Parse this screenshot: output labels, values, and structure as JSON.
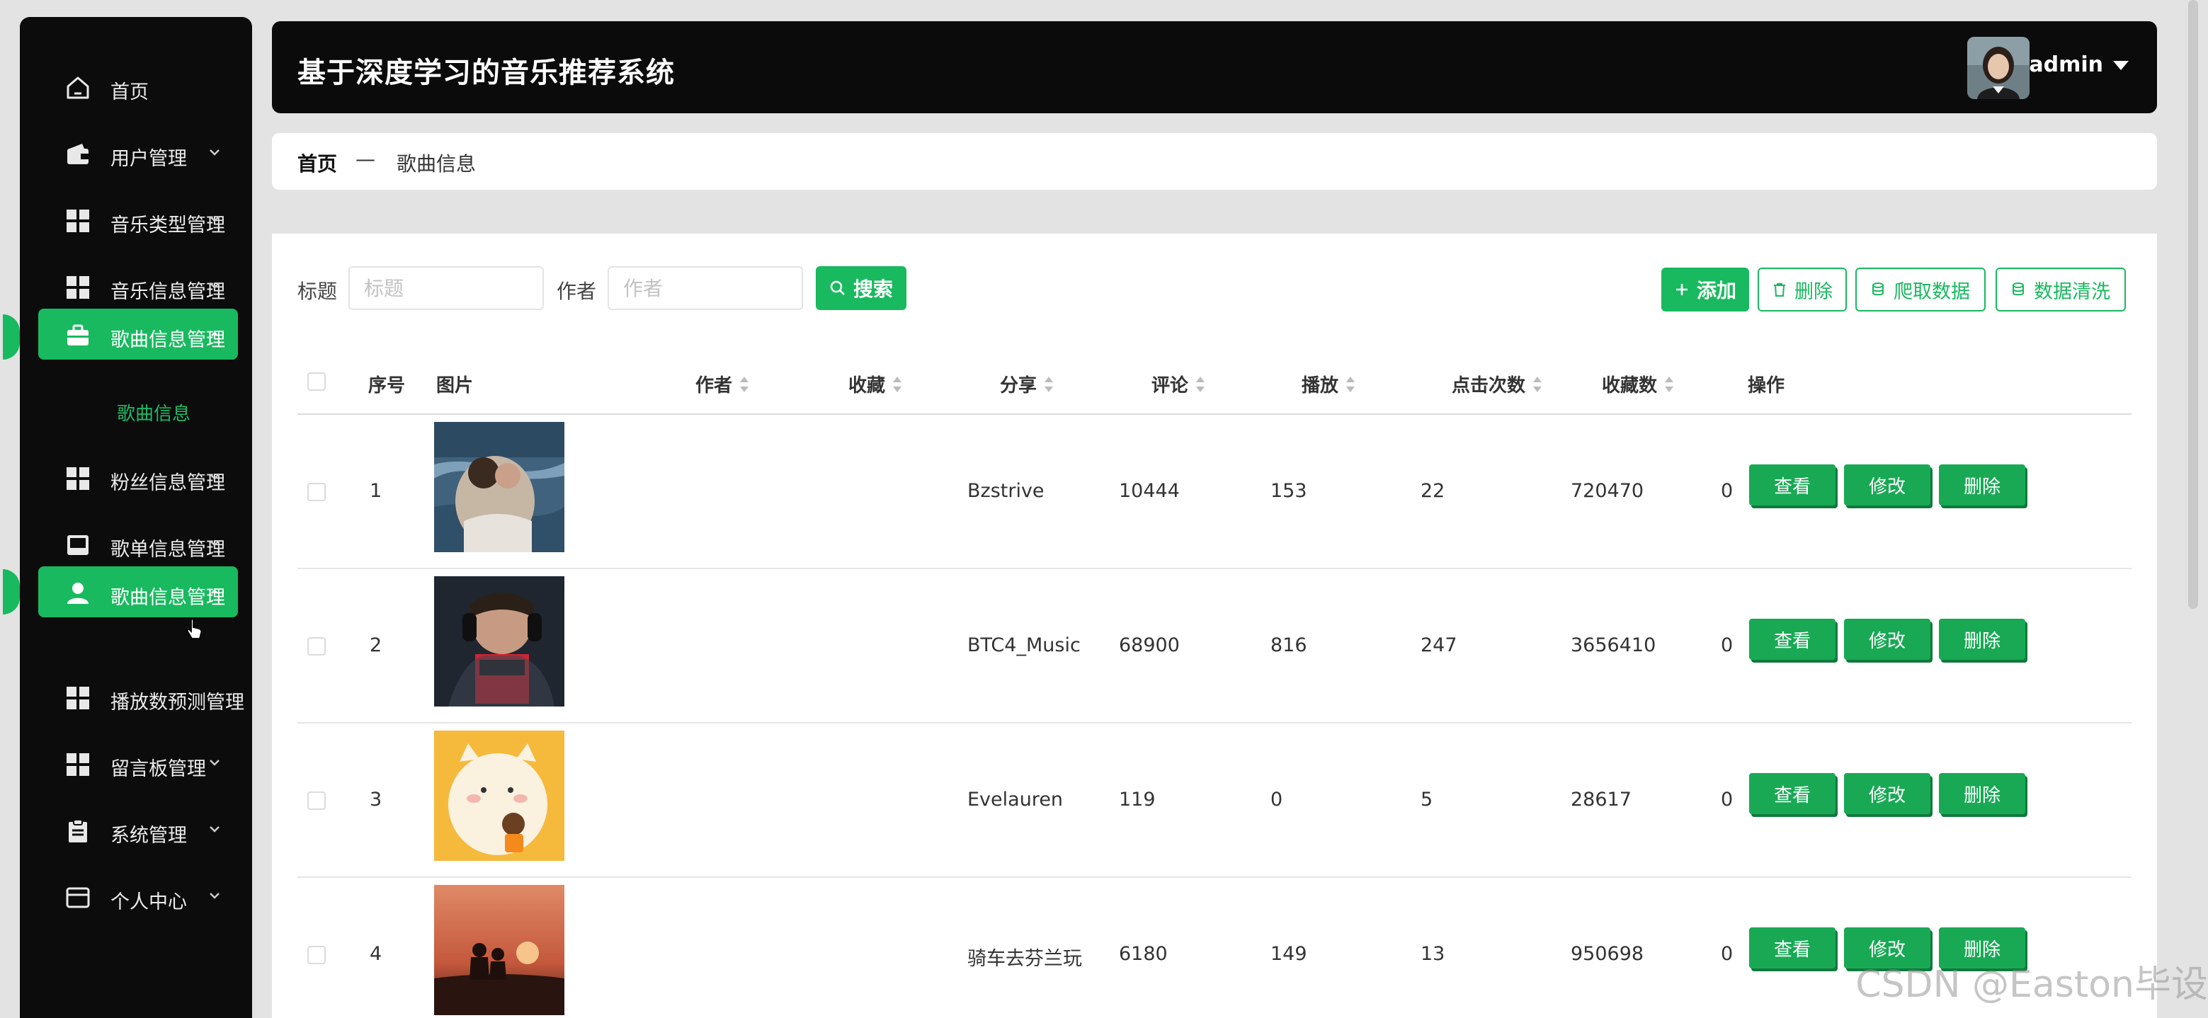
{
  "header": {
    "title": "基于深度学习的音乐推荐系统",
    "username": "admin"
  },
  "sidebar": {
    "items": [
      {
        "label": "首页",
        "icon": "home-icon"
      },
      {
        "label": "用户管理",
        "icon": "wallet-icon"
      },
      {
        "label": "音乐类型管理",
        "icon": "grid-icon"
      },
      {
        "label": "音乐信息管理",
        "icon": "grid-icon"
      },
      {
        "label": "歌曲信息管理",
        "icon": "briefcase-icon",
        "active": true
      },
      {
        "label": "歌曲信息",
        "sub": true
      },
      {
        "label": "粉丝信息管理",
        "icon": "grid-icon"
      },
      {
        "label": "歌单信息管理",
        "icon": "inbox-icon"
      },
      {
        "label": "歌曲信息管理",
        "icon": "user-icon",
        "active": true
      },
      {
        "label": "播放数预测管理",
        "icon": "grid-icon"
      },
      {
        "label": "留言板管理",
        "icon": "grid-icon"
      },
      {
        "label": "系统管理",
        "icon": "clipboard-icon"
      },
      {
        "label": "个人中心",
        "icon": "card-icon"
      }
    ]
  },
  "breadcrumb": {
    "home": "首页",
    "separator": "—",
    "current": "歌曲信息"
  },
  "search": {
    "title_label": "标题",
    "title_placeholder": "标题",
    "author_label": "作者",
    "author_placeholder": "作者",
    "search_button": "搜索"
  },
  "toolbar": {
    "add": "添加",
    "delete": "删除",
    "crawl": "爬取数据",
    "clean": "数据清洗"
  },
  "table": {
    "columns": [
      "序号",
      "图片",
      "作者",
      "收藏",
      "分享",
      "评论",
      "播放",
      "点击次数",
      "收藏数",
      "操作"
    ],
    "rows": [
      {
        "no": "1",
        "author": "Bzstrive",
        "fav": "10444",
        "share": "153",
        "comment": "22",
        "play": "720470",
        "clicks": "0",
        "favcount": "0"
      },
      {
        "no": "2",
        "author": "BTC4_Music",
        "fav": "68900",
        "share": "816",
        "comment": "247",
        "play": "3656410",
        "clicks": "0",
        "favcount": "0"
      },
      {
        "no": "3",
        "author": "Evelauren",
        "fav": "119",
        "share": "0",
        "comment": "5",
        "play": "28617",
        "clicks": "0",
        "favcount": "0"
      },
      {
        "no": "4",
        "author": "骑车去芬兰玩",
        "fav": "6180",
        "share": "149",
        "comment": "13",
        "play": "950698",
        "clicks": "0",
        "favcount": "0"
      }
    ],
    "actions": {
      "view": "查看",
      "edit": "修改",
      "delete": "删除"
    }
  },
  "watermark": "CSDN @Easton毕设",
  "colors": {
    "accent": "#19b95f",
    "sidebar": "#0c0c0c",
    "header": "#0b0b0b"
  }
}
